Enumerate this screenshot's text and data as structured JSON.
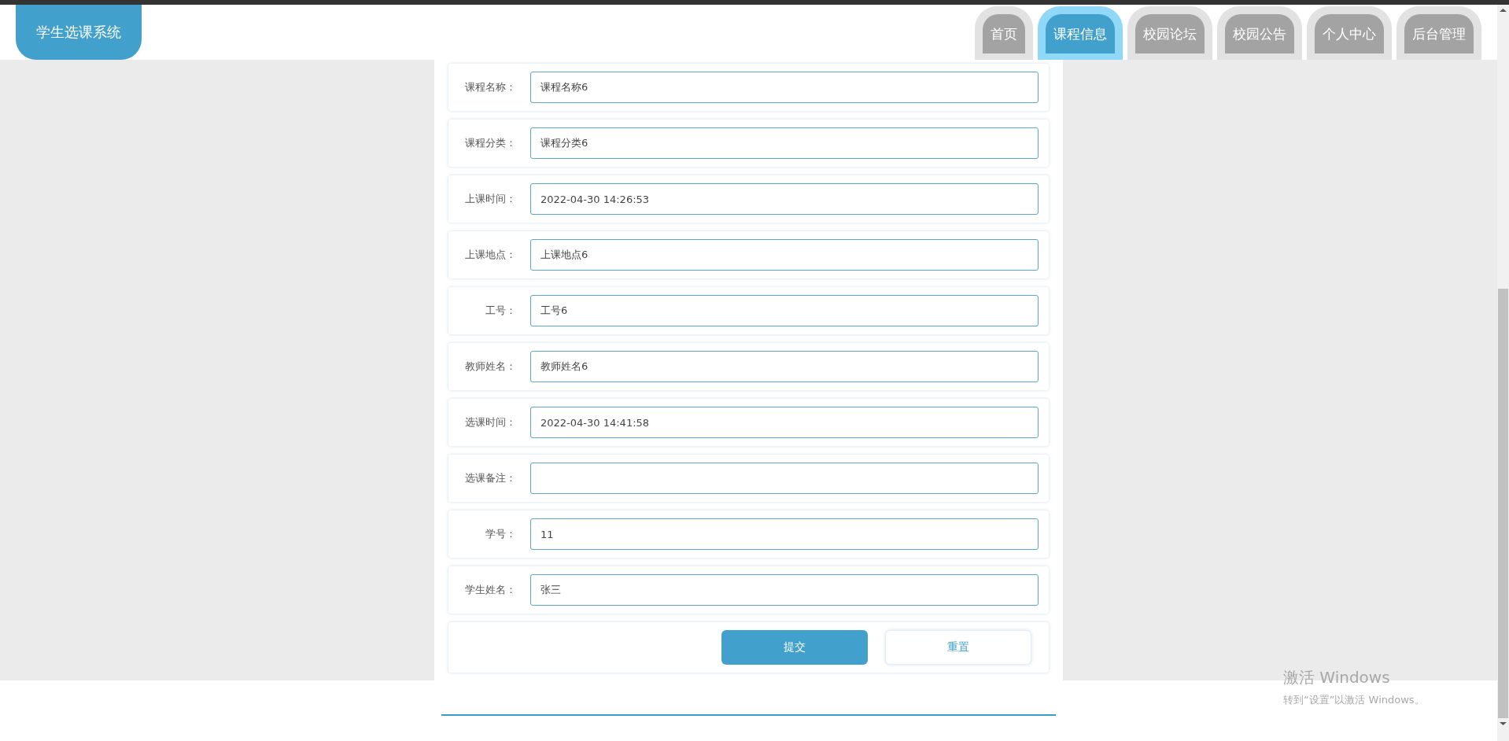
{
  "header": {
    "logo": "学生选课系统"
  },
  "nav": [
    {
      "label": "首页",
      "selected": false
    },
    {
      "label": "课程信息",
      "selected": true
    },
    {
      "label": "校园论坛",
      "selected": false
    },
    {
      "label": "校园公告",
      "selected": false
    },
    {
      "label": "个人中心",
      "selected": false
    },
    {
      "label": "后台管理",
      "selected": false
    }
  ],
  "form": {
    "fields": [
      {
        "label": "课程名称：",
        "value": "课程名称6"
      },
      {
        "label": "课程分类：",
        "value": "课程分类6"
      },
      {
        "label": "上课时间：",
        "value": "2022-04-30 14:26:53"
      },
      {
        "label": "上课地点：",
        "value": "上课地点6"
      },
      {
        "label": "工号：",
        "value": "工号6"
      },
      {
        "label": "教师姓名：",
        "value": "教师姓名6"
      },
      {
        "label": "选课时间：",
        "value": "2022-04-30 14:41:58"
      },
      {
        "label": "选课备注："
      },
      {
        "label": "学号：",
        "value": "11"
      },
      {
        "label": "学生姓名：",
        "value": "张三"
      }
    ],
    "buttons": [
      {
        "label": "提交",
        "kind": "primary"
      },
      {
        "label": "重置",
        "kind": "secondary"
      }
    ]
  },
  "os_overlay": {
    "title": "激活 Windows",
    "subtitle": "转到“设置”以激活 Windows。"
  }
}
